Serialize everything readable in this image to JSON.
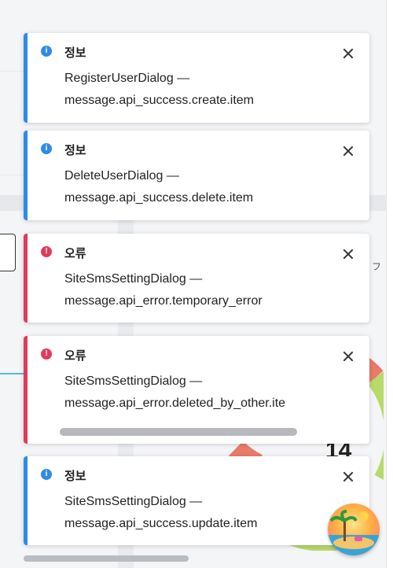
{
  "toasts": [
    {
      "type": "info",
      "title": "정보",
      "source": "RegisterUserDialog —",
      "message": "message.api_success.create.item"
    },
    {
      "type": "info",
      "title": "정보",
      "source": "DeleteUserDialog —",
      "message": "message.api_success.delete.item"
    },
    {
      "type": "error",
      "title": "오류",
      "source": "SiteSmsSettingDialog —",
      "message": "message.api_error.temporary_error"
    },
    {
      "type": "error",
      "title": "오류",
      "source": "SiteSmsSettingDialog —",
      "message": "message.api_error.deleted_by_other.ite"
    },
    {
      "type": "info",
      "title": "정보",
      "source": "SiteSmsSettingDialog —",
      "message": "message.api_success.update.item"
    }
  ],
  "background": {
    "number": "14",
    "edge_glyph": "フ"
  },
  "colors": {
    "info": "#2f8be6",
    "error": "#e03a5b"
  },
  "icons": {
    "info": "info-icon",
    "error": "alert-icon",
    "close": "close-icon",
    "avatar": "beach-avatar"
  }
}
